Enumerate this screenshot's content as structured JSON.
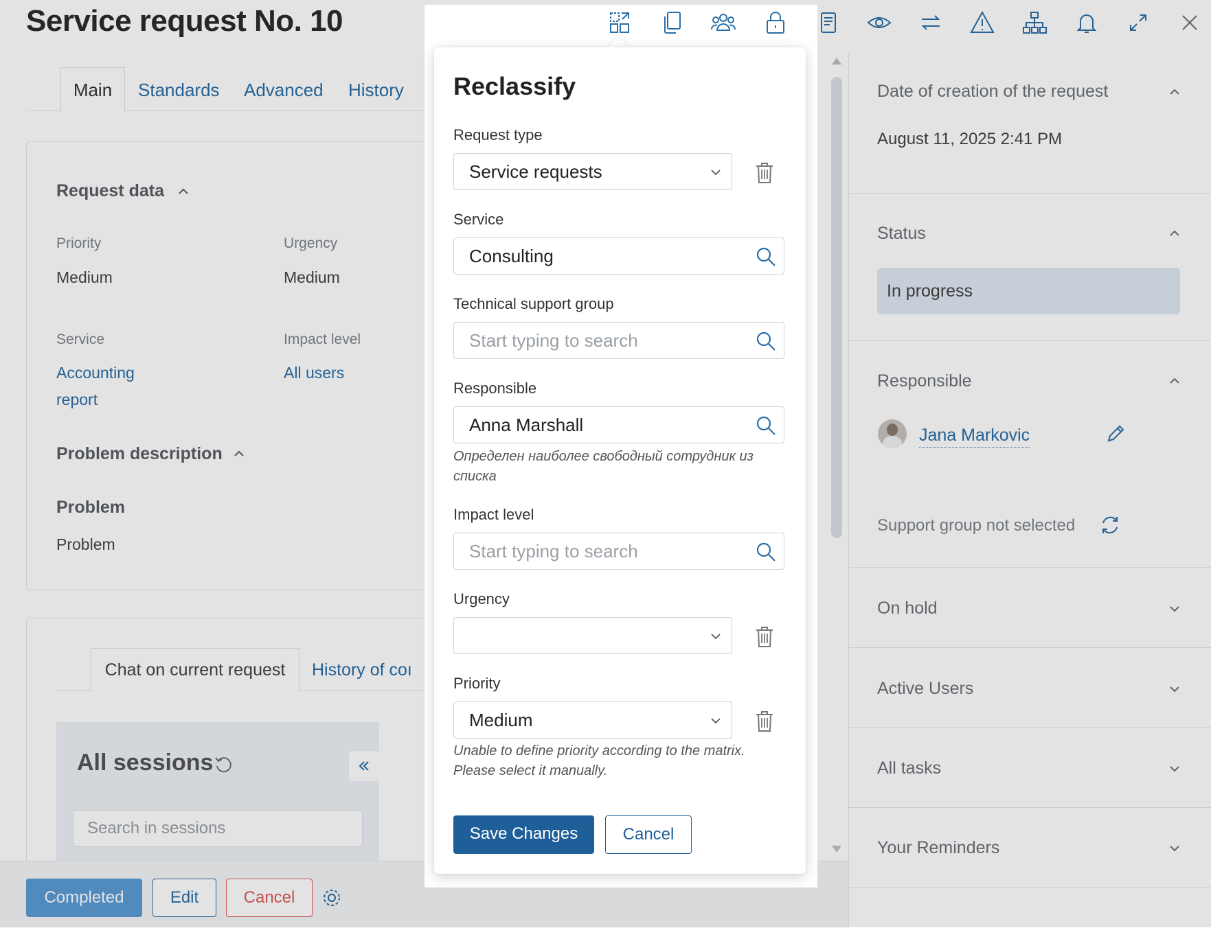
{
  "page": {
    "title": "Service request No. 10",
    "tabs": [
      {
        "label": "Main"
      },
      {
        "label": "Standards"
      },
      {
        "label": "Advanced"
      },
      {
        "label": "History"
      }
    ],
    "request_data": {
      "title": "Request data",
      "priority_label": "Priority",
      "priority_value": "Medium",
      "urgency_label": "Urgency",
      "urgency_value": "Medium",
      "service_label": "Service",
      "service_value_line1": "Accounting",
      "service_value_line2": "report",
      "impact_label": "Impact level",
      "impact_value": "All users"
    },
    "problem": {
      "title": "Problem description",
      "heading": "Problem",
      "value": "Problem"
    },
    "chat": {
      "tab_active": "Chat on current request",
      "tab_other": "History of coı",
      "sessions_title": "All sessions",
      "search_placeholder": "Search in sessions"
    },
    "footer": {
      "completed": "Completed",
      "edit": "Edit",
      "cancel": "Cancel"
    },
    "sidebar": {
      "creation_title": "Date of creation of the request",
      "creation_value": "August 11, 2025 2:41 PM",
      "status_title": "Status",
      "status_value": "In progress",
      "responsible_title": "Responsible",
      "responsible_name": "Jana Markovic",
      "support_group": "Support group not selected",
      "on_hold": "On hold",
      "active_users": "Active Users",
      "all_tasks": "All tasks",
      "reminders": "Your Reminders"
    }
  },
  "dialog": {
    "title": "Reclassify",
    "request_type": {
      "label": "Request type",
      "value": "Service requests"
    },
    "service": {
      "label": "Service",
      "value": "Consulting"
    },
    "tech_group": {
      "label": "Technical support group",
      "placeholder": "Start typing to search"
    },
    "responsible": {
      "label": "Responsible",
      "value": "Anna Marshall",
      "hint_line1": "Определен наиболее свободный сотрудник из",
      "hint_line2": "списка"
    },
    "impact": {
      "label": "Impact level",
      "placeholder": "Start typing to search"
    },
    "urgency": {
      "label": "Urgency",
      "value": ""
    },
    "priority": {
      "label": "Priority",
      "value": "Medium",
      "hint_line1": "Unable to define priority according to the matrix.",
      "hint_line2": "Please select it manually."
    },
    "save_label": "Save Changes",
    "cancel_label": "Cancel"
  },
  "colors": {
    "primary": "#1f5f99",
    "link": "#2a6ea8",
    "danger": "#e05a5a",
    "completed": "#5b9bd5"
  }
}
